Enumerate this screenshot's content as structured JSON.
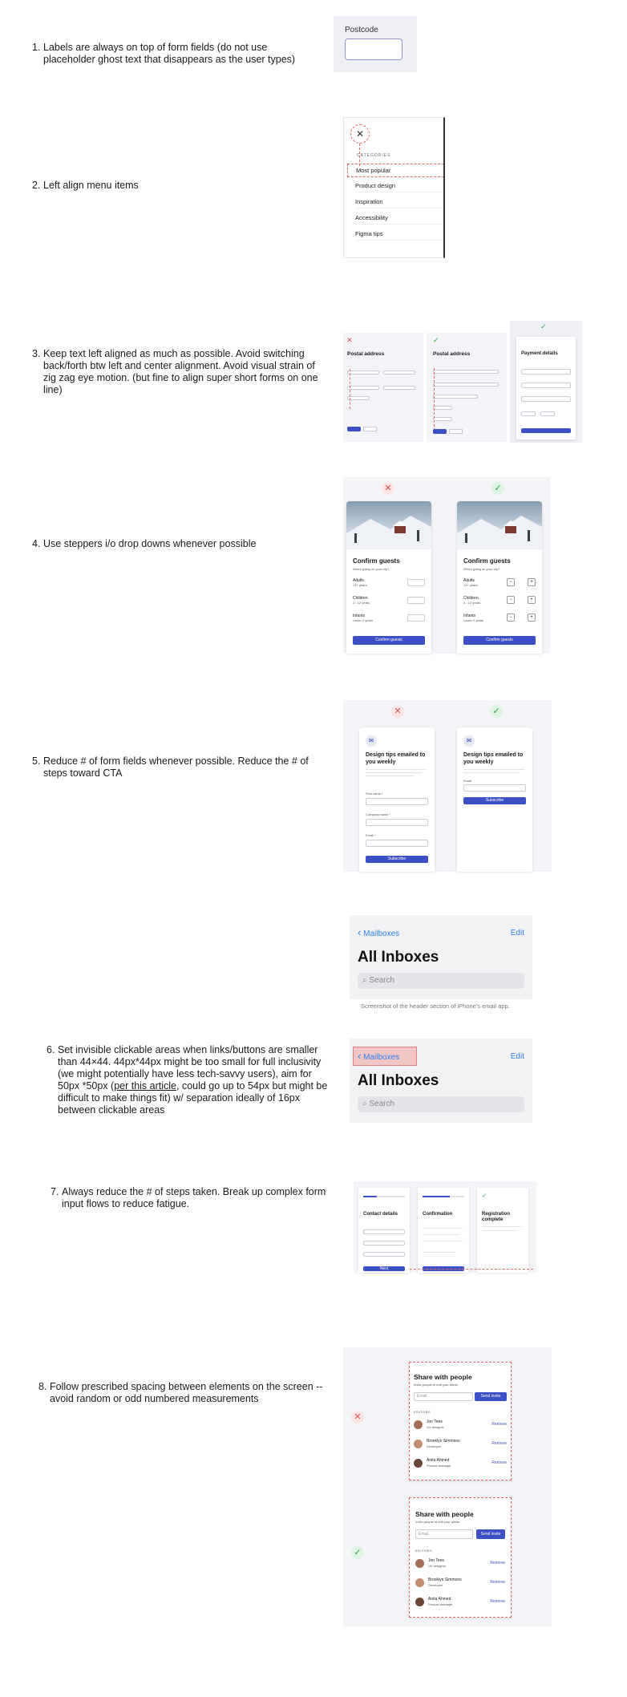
{
  "rules": [
    {
      "num": "1.",
      "text": "Labels are always on top of form fields (do not use placeholder ghost text that disappears as the user types)"
    },
    {
      "num": "2.",
      "text": "Left align menu items"
    },
    {
      "num": "3.",
      "text": "Keep text left aligned as much as possible. Avoid switching back/forth btw left and center alignment. Avoid visual strain of zig zag eye motion. (but fine to align super short forms on one line)"
    },
    {
      "num": "4.",
      "text": "Use steppers i/o drop downs whenever possible"
    },
    {
      "num": "5.",
      "text": "Reduce # of form fields whenever possible. Reduce the # of steps toward CTA"
    },
    {
      "num": "6.",
      "text_before": "Set invisible clickable areas when links/buttons are smaller than 44×44. 44px*44px might be too small for full inclusivity (we might potentially have less tech-savvy users), aim for 50px *50px (",
      "link": "per this article",
      "text_after": ", could go up to 54px but might be difficult to make things fit) w/ separation ideally of 16px between clickable areas"
    },
    {
      "num": "7.",
      "text": "Always reduce the # of steps taken. Break up complex form input flows to reduce fatigue."
    },
    {
      "num": "8.",
      "text": "Follow prescribed spacing between elements on the screen -- avoid random or odd numbered measurements"
    }
  ],
  "ex1": {
    "label": "Postcode"
  },
  "ex2": {
    "heading": "CATEGORIES",
    "close": "✕",
    "items": [
      "Most popular",
      "Product design",
      "Inspiration",
      "Accessibility",
      "Figma tips"
    ]
  },
  "ex3": {
    "bad_title": "Postal address",
    "good_title": "Postal address",
    "pay_title": "Payment details",
    "bad_mark": "✕",
    "good_mark": "✓"
  },
  "ex4": {
    "bad_mark": "✕",
    "good_mark": "✓",
    "title": "Confirm guests",
    "subtitle": "Who's going on your trip?",
    "rows": [
      {
        "label": "Adults",
        "sub": "13+ years"
      },
      {
        "label": "Children",
        "sub": "2 - 12 years"
      },
      {
        "label": "Infants",
        "sub": "Under 2 years"
      }
    ],
    "button": "Confirm guests"
  },
  "ex5": {
    "bad_mark": "✕",
    "good_mark": "✓",
    "title": "Design tips emailed to you weekly",
    "bad_fields": [
      "First name *",
      "Company name *",
      "Email *"
    ],
    "good_fields": [
      "Email"
    ],
    "button": "Subscribe"
  },
  "ex6": {
    "back": "Mailboxes",
    "edit": "Edit",
    "title": "All Inboxes",
    "search": "Search",
    "caption": "Screenshot of the header section of iPhone's email app."
  },
  "ex7": {
    "s1": "Contact details",
    "s2": "Confirmation",
    "s3": "Registration complete",
    "btn": "Next"
  },
  "ex8": {
    "bad_mark": "✕",
    "good_mark": "✓",
    "title": "Share with people",
    "subtitle": "Invite people to edit your article",
    "placeholder": "Email",
    "button": "Send invite",
    "section": "EDITORS",
    "people": [
      {
        "name": "Jon Tees",
        "role": "UX designer"
      },
      {
        "name": "Brooklyn Simmons",
        "role": "Developer"
      },
      {
        "name": "Anita Ahmed",
        "role": "Product manager"
      }
    ],
    "remove": "Remove"
  },
  "colors": {
    "accent": "#3d4fc4",
    "bad": "#d9534f",
    "good": "#2e9e4a",
    "ios_blue": "#2f80ed"
  }
}
